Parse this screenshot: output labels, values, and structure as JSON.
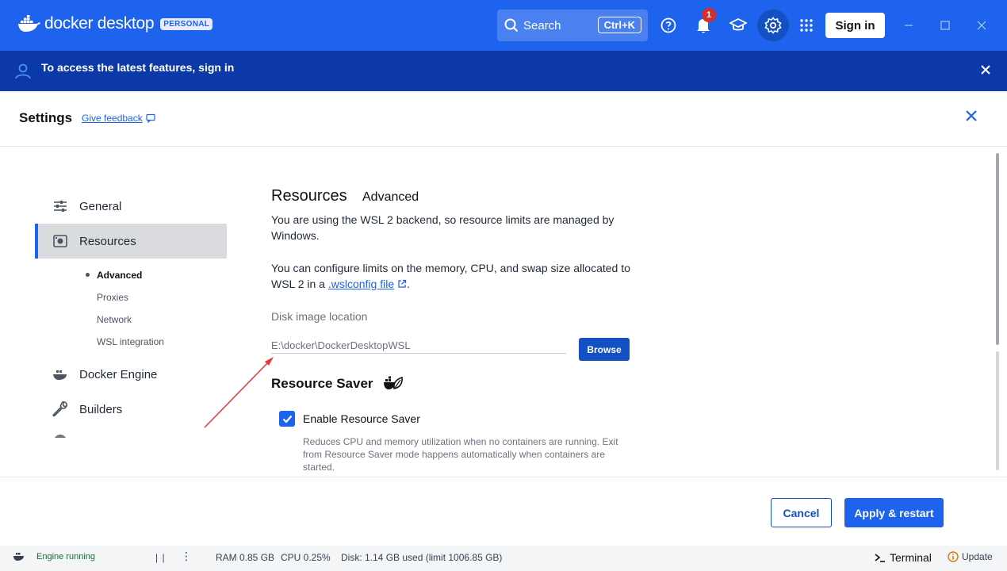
{
  "app": {
    "logo_text": "docker desktop",
    "plan_badge": "PERSONAL",
    "search_label": "Search",
    "search_shortcut": "Ctrl+K",
    "notification_count": "1",
    "sign_in_label": "Sign in"
  },
  "banner": {
    "text": "To access the latest features, sign in"
  },
  "settings": {
    "title": "Settings",
    "feedback_label": "Give feedback"
  },
  "sidebar": {
    "items": [
      {
        "label": "General",
        "icon": "sliders-icon"
      },
      {
        "label": "Resources",
        "icon": "resources-icon"
      },
      {
        "label": "Docker Engine",
        "icon": "engine-icon"
      },
      {
        "label": "Builders",
        "icon": "wrench-icon"
      }
    ],
    "sub_items": [
      {
        "label": "Advanced"
      },
      {
        "label": "Proxies"
      },
      {
        "label": "Network"
      },
      {
        "label": "WSL integration"
      }
    ]
  },
  "main": {
    "title": "Resources",
    "subtitle": "Advanced",
    "para1": "You are using the WSL 2 backend, so resource limits are managed by Windows.",
    "para2_prefix": "You can configure limits on the memory, CPU, and swap size allocated to WSL 2 in a ",
    "para2_link": ".wslconfig file",
    "para2_suffix": ".",
    "disk_label": "Disk image location",
    "disk_value": "E:\\docker\\DockerDesktopWSL",
    "browse_label": "Browse",
    "resource_saver_title": "Resource Saver",
    "enable_label": "Enable Resource Saver",
    "enable_checked": true,
    "enable_desc": "Reduces CPU and memory utilization when no containers are running. Exit from Resource Saver mode happens automatically when containers are started."
  },
  "footer": {
    "cancel_label": "Cancel",
    "apply_label": "Apply & restart"
  },
  "status": {
    "engine": "Engine running",
    "pause": "| |",
    "menu": "⋮",
    "ram": "RAM 0.85 GB",
    "cpu": "CPU 0.25%",
    "disk": "Disk: 1.14 GB used (limit 1006.85 GB)",
    "terminal": "Terminal",
    "update": "Update"
  },
  "colors": {
    "brand": "#1d63ed",
    "banner": "#0b3aa8",
    "annotation_arrow": "#e53935"
  }
}
